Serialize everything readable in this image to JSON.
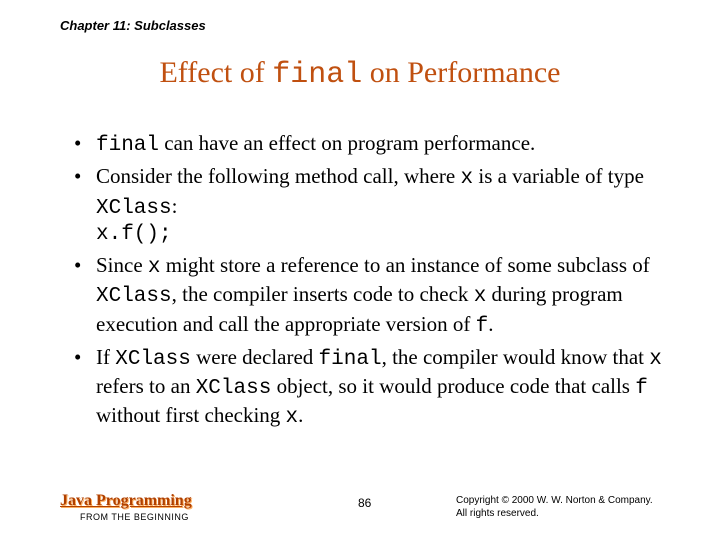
{
  "chapter": "Chapter 11: Subclasses",
  "title_pre": "Effect of ",
  "title_code": "final",
  "title_post": " on Performance",
  "bullets": {
    "b1_pre": "",
    "b1_code": "final",
    "b1_post": " can have an effect on program performance.",
    "b2_pre": "Consider the following method call, where ",
    "b2_code1": "x",
    "b2_mid1": " is a variable of type ",
    "b2_code2": "XClass",
    "b2_mid2": ":",
    "b2_line2": "x.f();",
    "b3_pre": "Since ",
    "b3_code1": "x",
    "b3_mid1": " might store a reference to an instance of some subclass of ",
    "b3_code2": "XClass",
    "b3_mid2": ", the compiler inserts code to check ",
    "b3_code3": "x",
    "b3_mid3": " during program execution and call the appropriate version of ",
    "b3_code4": "f",
    "b3_mid4": ".",
    "b4_pre": "If ",
    "b4_code1": "XClass",
    "b4_mid1": " were declared ",
    "b4_code2": "final",
    "b4_mid2": ", the compiler would know that ",
    "b4_code3": "x",
    "b4_mid3": " refers to an ",
    "b4_code4": "XClass",
    "b4_mid4": " object, so it would produce code that calls ",
    "b4_code5": "f",
    "b4_mid5": " without first checking ",
    "b4_code6": "x",
    "b4_mid6": "."
  },
  "footer": {
    "book_title": "Java Programming",
    "book_sub": "FROM THE BEGINNING",
    "page_num": "86",
    "copyright_l1": "Copyright © 2000 W. W. Norton & Company.",
    "copyright_l2": "All rights reserved."
  }
}
